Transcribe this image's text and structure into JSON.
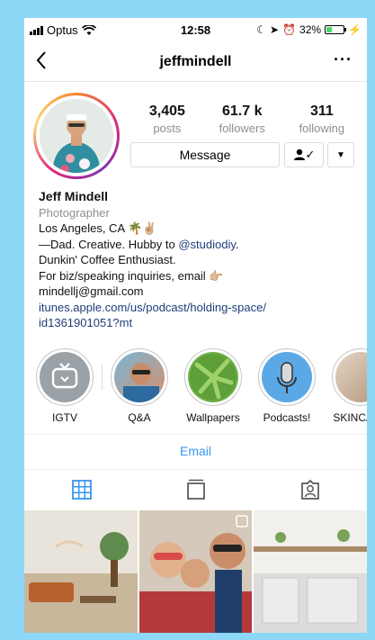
{
  "status_bar": {
    "carrier": "Optus",
    "time": "12:58",
    "battery": "32%"
  },
  "nav": {
    "back_icon": "chevron-left-icon",
    "username": "jeffmindell",
    "more_icon": "ellipsis-icon"
  },
  "stats": [
    {
      "value": "3,405",
      "label": "posts"
    },
    {
      "value": "61.7 k",
      "label": "followers"
    },
    {
      "value": "311",
      "label": "following"
    }
  ],
  "actions": {
    "message_label": "Message",
    "follow_check": "✓"
  },
  "bio": {
    "name": "Jeff Mindell",
    "category": "Photographer",
    "line1": "Los Angeles, CA 🌴✌🏼",
    "line2_prefix": "—Dad. Creative. Hubby to ",
    "line2_mention": "@studiodiy",
    "line2_suffix": ".",
    "line3": "Dunkin' Coffee Enthusiast.",
    "line4": "For biz/speaking inquiries, email 👉🏼",
    "line5": "mindellj@gmail.com",
    "link1": "itunes.apple.com/us/podcast/holding-space/",
    "link2": "id1361901051?mt"
  },
  "highlights": [
    {
      "label": "IGTV",
      "icon": "igtv-icon"
    },
    {
      "label": "Q&A"
    },
    {
      "label": "Wallpapers"
    },
    {
      "label": "Podcasts!",
      "icon": "microphone-icon"
    },
    {
      "label": "SKINCARE"
    }
  ],
  "contact": {
    "email_label": "Email"
  },
  "tabs": [
    {
      "name": "grid",
      "icon": "grid-icon"
    },
    {
      "name": "igtv",
      "icon": "igtv-tab-icon"
    },
    {
      "name": "tagged",
      "icon": "tagged-icon"
    }
  ],
  "colors": {
    "link": "#1f3d7a",
    "email_action": "#3897f0",
    "tab_active": "#3897f0",
    "background": "#8dd7f7"
  }
}
